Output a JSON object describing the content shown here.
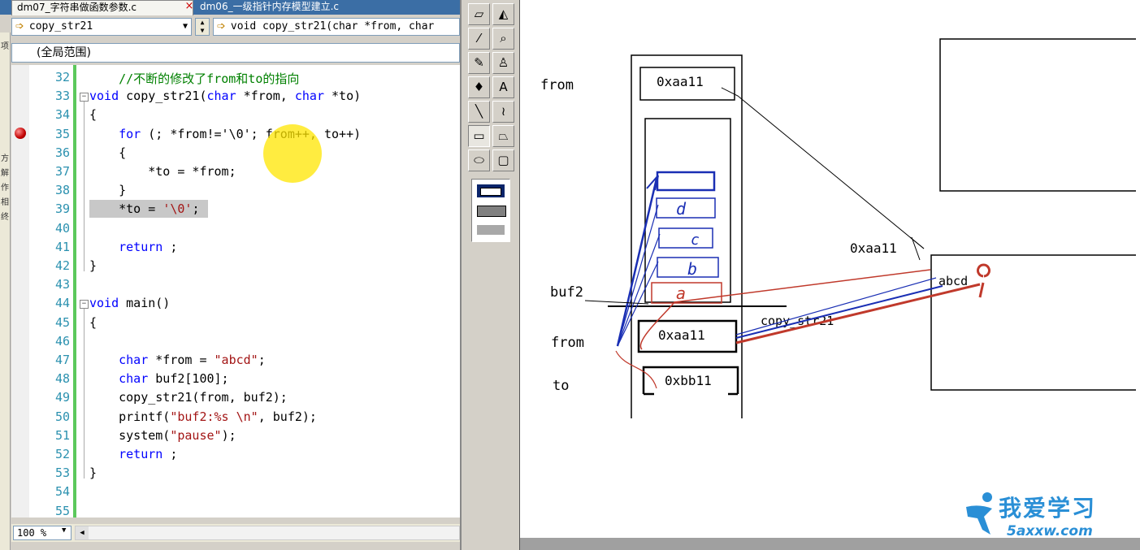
{
  "ide": {
    "tabs": [
      {
        "label": "dm07_字符串做函数参数.c",
        "active": true
      },
      {
        "label": "dm06_一级指针内存模型建立.c",
        "active": false
      }
    ],
    "function_combo": "copy_str21",
    "signature_combo": "void copy_str21(char *from, char",
    "scope": "(全局范围)",
    "zoom": "100 %",
    "left_strip_chars": [
      "项",
      "方",
      "解",
      "作",
      "相",
      "终"
    ],
    "lines": [
      {
        "num": "32",
        "parts": [
          {
            "t": "    //不断的修改了from和to的指向",
            "c": "cm"
          }
        ]
      },
      {
        "num": "33",
        "parts": [
          {
            "t": "void",
            "c": "kw"
          },
          {
            "t": " copy_str21(",
            "c": ""
          },
          {
            "t": "char",
            "c": "kw"
          },
          {
            "t": " *from, ",
            "c": ""
          },
          {
            "t": "char",
            "c": "kw"
          },
          {
            "t": " *to)",
            "c": ""
          }
        ]
      },
      {
        "num": "34",
        "parts": [
          {
            "t": "{",
            "c": ""
          }
        ]
      },
      {
        "num": "35",
        "parts": [
          {
            "t": "    ",
            "c": ""
          },
          {
            "t": "for",
            "c": "kw"
          },
          {
            "t": " (; *from!='\\0'; from++, to++)",
            "c": ""
          }
        ]
      },
      {
        "num": "36",
        "parts": [
          {
            "t": "    {",
            "c": ""
          }
        ]
      },
      {
        "num": "37",
        "parts": [
          {
            "t": "        *to = *from;",
            "c": ""
          }
        ]
      },
      {
        "num": "38",
        "parts": [
          {
            "t": "    }",
            "c": ""
          }
        ]
      },
      {
        "num": "39",
        "parts": [
          {
            "t": "    *to = ",
            "c": ""
          },
          {
            "t": "'\\0'",
            "c": "st"
          },
          {
            "t": ";",
            "c": ""
          }
        ]
      },
      {
        "num": "40",
        "parts": []
      },
      {
        "num": "41",
        "parts": [
          {
            "t": "    ",
            "c": ""
          },
          {
            "t": "return",
            "c": "kw"
          },
          {
            "t": " ;",
            "c": ""
          }
        ]
      },
      {
        "num": "42",
        "parts": [
          {
            "t": "}",
            "c": ""
          }
        ]
      },
      {
        "num": "43",
        "parts": []
      },
      {
        "num": "44",
        "parts": [
          {
            "t": "void",
            "c": "kw"
          },
          {
            "t": " main()",
            "c": ""
          }
        ]
      },
      {
        "num": "45",
        "parts": [
          {
            "t": "{",
            "c": ""
          }
        ]
      },
      {
        "num": "46",
        "parts": []
      },
      {
        "num": "47",
        "parts": [
          {
            "t": "    ",
            "c": ""
          },
          {
            "t": "char",
            "c": "kw"
          },
          {
            "t": " *from = ",
            "c": ""
          },
          {
            "t": "\"abcd\"",
            "c": "st"
          },
          {
            "t": ";",
            "c": ""
          }
        ]
      },
      {
        "num": "48",
        "parts": [
          {
            "t": "    ",
            "c": ""
          },
          {
            "t": "char",
            "c": "kw"
          },
          {
            "t": " buf2[100];",
            "c": ""
          }
        ]
      },
      {
        "num": "49",
        "parts": [
          {
            "t": "    copy_str21(from, buf2);",
            "c": ""
          }
        ]
      },
      {
        "num": "50",
        "parts": [
          {
            "t": "    printf(",
            "c": ""
          },
          {
            "t": "\"buf2:%s \\n\"",
            "c": "st"
          },
          {
            "t": ", buf2);",
            "c": ""
          }
        ]
      },
      {
        "num": "51",
        "parts": [
          {
            "t": "    system(",
            "c": ""
          },
          {
            "t": "\"pause\"",
            "c": "st"
          },
          {
            "t": ");",
            "c": ""
          }
        ]
      },
      {
        "num": "52",
        "parts": [
          {
            "t": "    ",
            "c": ""
          },
          {
            "t": "return",
            "c": "kw"
          },
          {
            "t": " ;",
            "c": ""
          }
        ]
      },
      {
        "num": "53",
        "parts": [
          {
            "t": "}",
            "c": ""
          }
        ]
      },
      {
        "num": "54",
        "parts": []
      },
      {
        "num": "55",
        "parts": []
      }
    ]
  },
  "paint_tools": [
    {
      "name": "eraser-tool",
      "glyph": "▱"
    },
    {
      "name": "fill-tool",
      "glyph": "◭"
    },
    {
      "name": "color-picker-tool",
      "glyph": "⁄"
    },
    {
      "name": "magnifier-tool",
      "glyph": "⌕"
    },
    {
      "name": "pencil-tool",
      "glyph": "✎"
    },
    {
      "name": "brush-tool",
      "glyph": "♙"
    },
    {
      "name": "airbrush-tool",
      "glyph": "♦"
    },
    {
      "name": "text-tool",
      "glyph": "A"
    },
    {
      "name": "line-tool",
      "glyph": "╲"
    },
    {
      "name": "curve-tool",
      "glyph": "≀"
    },
    {
      "name": "rectangle-tool",
      "glyph": "▭"
    },
    {
      "name": "polygon-tool",
      "glyph": "⏢"
    },
    {
      "name": "ellipse-tool",
      "glyph": "⬭"
    },
    {
      "name": "rounded-rect-tool",
      "glyph": "▢"
    }
  ],
  "diagram": {
    "label_from_top": "from",
    "label_buf2": "buf2",
    "label_from_bottom": "from",
    "label_to": "to",
    "box_top_value": "0xaa11",
    "box_from_value": "0xaa11",
    "box_to_value": "0xbb11",
    "heap_address": "0xaa11",
    "heap_content": "abcd",
    "call_label": "copy_str21",
    "buf_chars": [
      "d",
      "c",
      "b",
      "a"
    ]
  },
  "watermark": {
    "text": "我爱学习",
    "url": "5axxw.com"
  },
  "colors": {
    "blue_ink": "#1a2fb4",
    "red_ink": "#c0392b",
    "comment_green": "#008000",
    "keyword_blue": "#0000ff"
  }
}
